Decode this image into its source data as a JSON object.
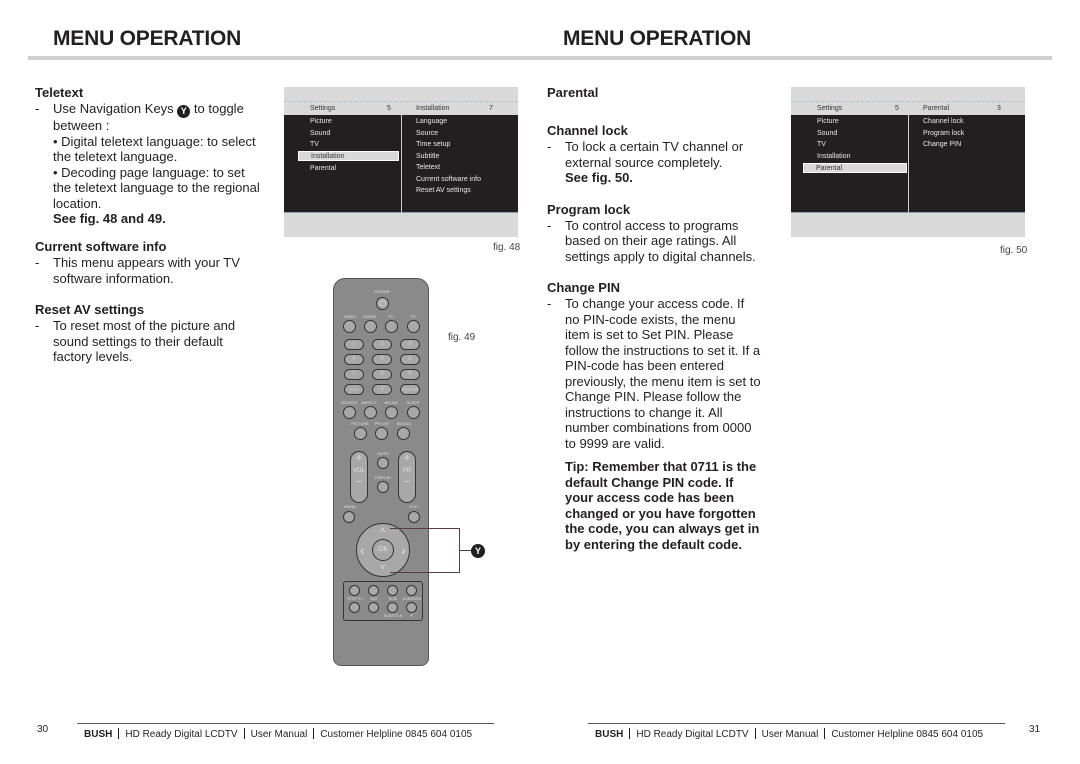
{
  "left_page": {
    "title": "MENU OPERATION",
    "teletext": {
      "heading": "Teletext",
      "dash": "-",
      "line1_a": "Use Navigation Keys",
      "key_glyph": "Y",
      "line1_b": "to toggle between :",
      "bullet1": "• Digital teletext language: to select the teletext language.",
      "bullet2": "• Decoding page language: to set the teletext language to the regional location.",
      "see": "See fig. 48 and 49."
    },
    "software": {
      "heading": "Current software info",
      "dash": "-",
      "text": "This menu appears with your TV software information."
    },
    "reset": {
      "heading": "Reset AV settings",
      "dash": "-",
      "text": "To reset most of the picture and sound settings to their default factory levels."
    },
    "fig48": {
      "label": "fig. 48",
      "left_header": "Settings",
      "left_count": "5",
      "right_header": "Installation",
      "right_count": "7",
      "left_items": [
        "Picture",
        "Sound",
        "TV",
        "Installation",
        "Parental"
      ],
      "selected_left": "Installation",
      "right_items": [
        "Language",
        "Source",
        "Time setup",
        "Subtitle",
        "Teletext",
        "Current software info",
        "Reset AV settings"
      ]
    },
    "fig49": {
      "label": "fig. 49",
      "callout": "Y",
      "remote": {
        "power": "POWER",
        "row1": [
          "VIDEO",
          "SCART",
          "PC",
          "TV"
        ],
        "digits": [
          "1",
          "2",
          "3",
          "4",
          "5",
          "6",
          "7",
          "8",
          "9",
          "EPG",
          "0",
          "PRE PR"
        ],
        "row_src": [
          "SOURCE",
          "ASPECT",
          "NICAM",
          "SLEEP"
        ],
        "row_pic": [
          "PICTURE",
          "PR LIST",
          "SOUND"
        ],
        "vol": "VOL",
        "pr": "PR",
        "plus": "+",
        "minus": "−",
        "mute": "MUTE",
        "display": "DISPLAY",
        "menu": "MENU",
        "exit": "EXIT",
        "ok": "OK",
        "up": "˄",
        "down": "˅",
        "left": "‹",
        "right": "›",
        "tt_row1": [
          "TEXT/TV",
          "MIX",
          "SIZE",
          "SUBPAGE"
        ],
        "tt_row2": [
          "INDEX",
          "CANCEL",
          "HOLD",
          "REVEAL"
        ],
        "tt_sub": [
          "SUBTITLE",
          "✓"
        ]
      }
    },
    "page_number": "30"
  },
  "right_page": {
    "title": "MENU OPERATION",
    "parental": {
      "heading": "Parental"
    },
    "channel_lock": {
      "heading": "Channel lock",
      "dash": "-",
      "text": "To lock a certain TV channel or external source completely.",
      "see": "See fig. 50."
    },
    "program_lock": {
      "heading": "Program lock",
      "dash": "-",
      "text": "To control access to programs based on their age ratings. All settings apply to digital channels."
    },
    "change_pin": {
      "heading": "Change PIN",
      "dash": "-",
      "text": "To change your access code. If no PIN-code exists, the menu item is set to Set PIN. Please follow the instructions to set it. If a PIN-code has been entered previously, the menu item is set to Change PIN. Please follow the instructions to change it. All number combinations from 0000 to 9999 are valid."
    },
    "tip": "Tip: Remember that 0711 is the default Change PIN code. If your access code has been changed or you have forgotten the code, you can always get in by entering the default code.",
    "fig50": {
      "label": "fig. 50",
      "left_header": "Settings",
      "left_count": "5",
      "right_header": "Parental",
      "right_count": "3",
      "left_items": [
        "Picture",
        "Sound",
        "TV",
        "Installation",
        "Parental"
      ],
      "selected_left": "Parental",
      "right_items": [
        "Channel lock",
        "Program lock",
        "Change PIN"
      ]
    },
    "page_number": "31"
  },
  "footer": {
    "brand": "BUSH",
    "product": "HD Ready Digital LCDTV",
    "doc": "User Manual",
    "helpline": "Customer Helpline 0845 604 0105"
  }
}
